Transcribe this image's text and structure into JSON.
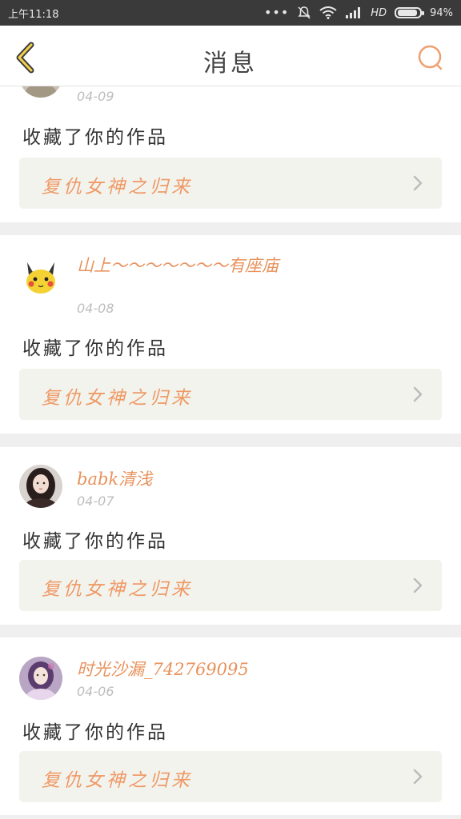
{
  "status_bar": {
    "time": "上午11:18",
    "network": "HD",
    "battery": "94%",
    "battery_level": 0.94
  },
  "header": {
    "title": "消息",
    "back_icon": "chevron-left-icon",
    "search_icon": "search-icon"
  },
  "notifications": [
    {
      "username": "",
      "date": "04-09",
      "action": "收藏了你的作品",
      "work_title": "复仇女神之归来",
      "avatar": "avatar-partial"
    },
    {
      "username": "山上～～～～～～～有座庙",
      "date": "04-08",
      "action": "收藏了你的作品",
      "work_title": "复仇女神之归来",
      "avatar": "pikachu-avatar"
    },
    {
      "username": "babk清浅",
      "date": "04-07",
      "action": "收藏了你的作品",
      "work_title": "复仇女神之归来",
      "avatar": "girl-photo-avatar"
    },
    {
      "username": "时光沙漏_742769095",
      "date": "04-06",
      "action": "收藏了你的作品",
      "work_title": "复仇女神之归来",
      "avatar": "anime-girl-avatar"
    }
  ],
  "colors": {
    "accent": "#e8925c",
    "header_bg": "#ffffff",
    "page_bg": "#efefef",
    "link_bg": "#f3f3ee"
  }
}
